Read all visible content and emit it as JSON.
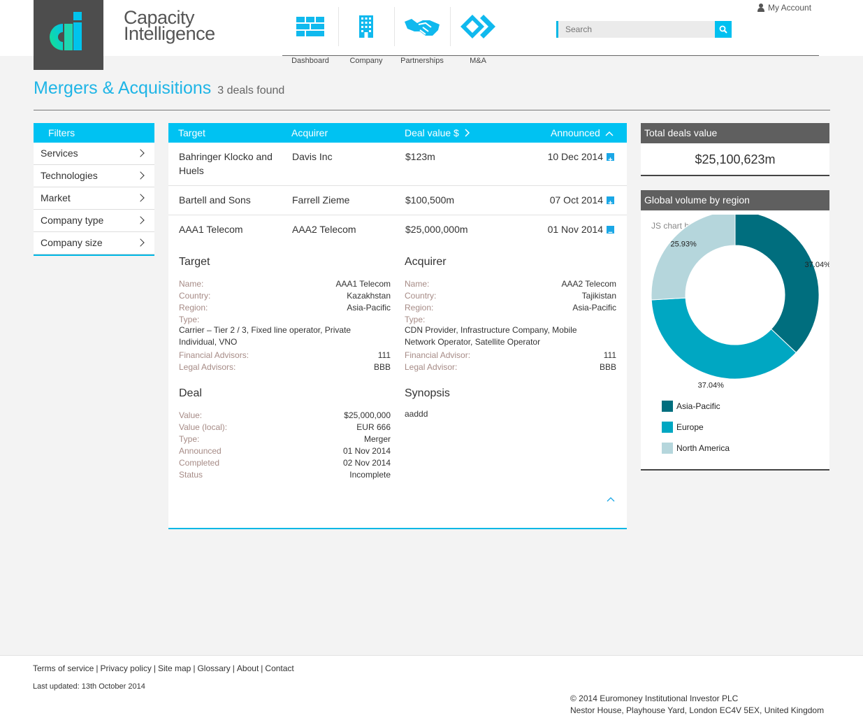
{
  "brand": {
    "line1": "Capacity",
    "line2": "Intelligence"
  },
  "nav": [
    {
      "label": "Dashboard",
      "icon": "dashboard-icon"
    },
    {
      "label": "Company",
      "icon": "building-icon"
    },
    {
      "label": "Partnerships",
      "icon": "handshake-icon"
    },
    {
      "label": "M&A",
      "icon": "merge-icon"
    }
  ],
  "search": {
    "placeholder": "Search"
  },
  "account": {
    "label": "My Account"
  },
  "page": {
    "title": "Mergers & Acquisitions",
    "subtitle": "3 deals found"
  },
  "filters": {
    "header": "Filters",
    "items": [
      "Services",
      "Technologies",
      "Market",
      "Company type",
      "Company size"
    ]
  },
  "table": {
    "headers": {
      "target": "Target",
      "acquirer": "Acquirer",
      "value": "Deal value $",
      "announced": "Announced"
    },
    "rows": [
      {
        "target": "Bahringer Klocko and Huels",
        "acquirer": "Davis Inc",
        "value": "$123m",
        "announced": "10 Dec 2014",
        "toggle": "+"
      },
      {
        "target": "Bartell and Sons",
        "acquirer": "Farrell Zieme",
        "value": "$100,500m",
        "announced": "07 Oct 2014",
        "toggle": "+"
      },
      {
        "target": "AAA1 Telecom",
        "acquirer": "AAA2 Telecom",
        "value": "$25,000,000m",
        "announced": "01 Nov 2014",
        "toggle": "−"
      }
    ]
  },
  "detail": {
    "target": {
      "title": "Target",
      "name_k": "Name:",
      "name_v": "AAA1 Telecom",
      "country_k": "Country:",
      "country_v": "Kazakhstan",
      "region_k": "Region:",
      "region_v": "Asia-Pacific",
      "type_k": "Type:",
      "type_v1": "Carrier – Tier 2 / 3, Fixed line operator, Private",
      "type_v2": "Individual, VNO",
      "fin_k": "Financial Advisors:",
      "fin_v": "111",
      "legal_k": "Legal Advisors:",
      "legal_v": "BBB"
    },
    "acquirer": {
      "title": "Acquirer",
      "name_k": "Name:",
      "name_v": "AAA2 Telecom",
      "country_k": "Country:",
      "country_v": "Tajikistan",
      "region_k": "Region:",
      "region_v": "Asia-Pacific",
      "type_k": "Type:",
      "type_v1": "CDN Provider, Infrastructure Company, Mobile",
      "type_v2": "Network Operator, Satellite Operator",
      "fin_k": "Financial Advisor:",
      "fin_v": "111",
      "legal_k": "Legal Advisor:",
      "legal_v": "BBB"
    },
    "deal": {
      "title": "Deal",
      "value_k": "Value:",
      "value_v": "$25,000,000",
      "local_k": "Value (local):",
      "local_v": "EUR 666",
      "type_k": "Type:",
      "type_v": "Merger",
      "ann_k": "Announced",
      "ann_v": "01 Nov 2014",
      "comp_k": "Completed",
      "comp_v": "02 Nov 2014",
      "status_k": "Status",
      "status_v": "Incomplete"
    },
    "synopsis": {
      "title": "Synopsis",
      "text": "aaddd"
    }
  },
  "total": {
    "title": "Total deals value",
    "value": "$25,100,623m"
  },
  "region": {
    "title": "Global volume by region",
    "credit": "JS chart by amCharts"
  },
  "chart_data": {
    "type": "pie",
    "title": "Global volume by region",
    "categories": [
      "Asia-Pacific",
      "Europe",
      "North America"
    ],
    "values": [
      37.04,
      37.04,
      25.93
    ],
    "labels": [
      "37.04%",
      "37.04%",
      "25.93%"
    ],
    "colors": [
      "#006e7e",
      "#00a7c2",
      "#b5d6dc"
    ],
    "legend": "bottom"
  },
  "footer": {
    "links": [
      "Terms of service",
      "Privacy policy",
      "Site map",
      "Glossary",
      "About",
      "Contact"
    ],
    "updated": "Last updated: 13th October 2014",
    "copyright": "© 2014 Euromoney Institutional Investor PLC",
    "address": "Nestor House, Playhouse Yard, London EC4V 5EX, United Kingdom"
  }
}
